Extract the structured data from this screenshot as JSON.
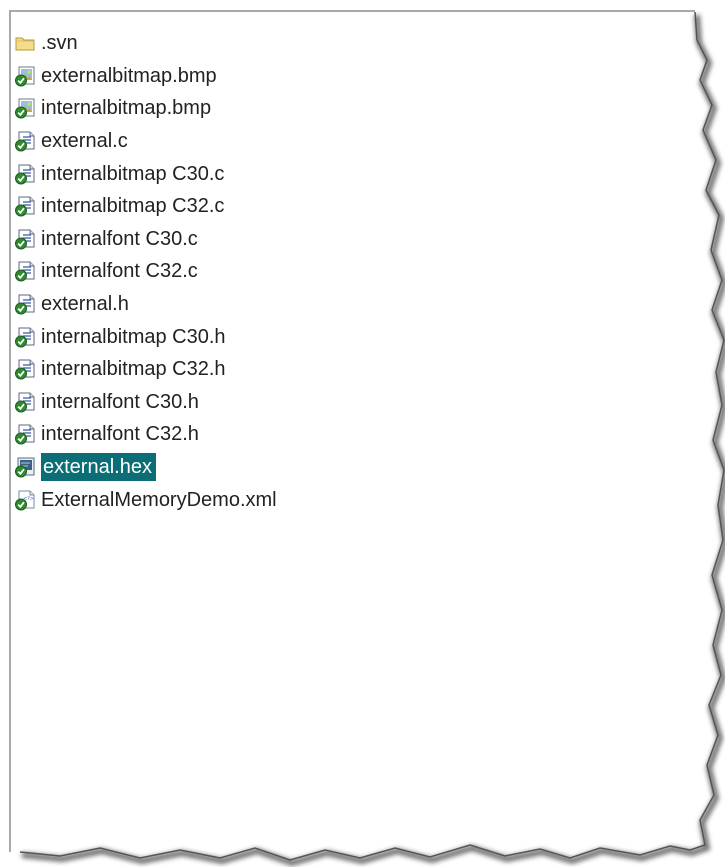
{
  "file_list": {
    "items": [
      {
        "name": ".svn",
        "icon": "folder-icon",
        "selected": false
      },
      {
        "name": "externalbitmap.bmp",
        "icon": "bitmap-file-icon",
        "selected": false
      },
      {
        "name": "internalbitmap.bmp",
        "icon": "bitmap-file-icon",
        "selected": false
      },
      {
        "name": "external.c",
        "icon": "source-file-icon",
        "selected": false
      },
      {
        "name": "internalbitmap C30.c",
        "icon": "source-file-icon",
        "selected": false
      },
      {
        "name": "internalbitmap C32.c",
        "icon": "source-file-icon",
        "selected": false
      },
      {
        "name": "internalfont C30.c",
        "icon": "source-file-icon",
        "selected": false
      },
      {
        "name": "internalfont C32.c",
        "icon": "source-file-icon",
        "selected": false
      },
      {
        "name": "external.h",
        "icon": "source-file-icon",
        "selected": false
      },
      {
        "name": "internalbitmap C30.h",
        "icon": "source-file-icon",
        "selected": false
      },
      {
        "name": "internalbitmap C32.h",
        "icon": "source-file-icon",
        "selected": false
      },
      {
        "name": "internalfont C30.h",
        "icon": "source-file-icon",
        "selected": false
      },
      {
        "name": "internalfont C32.h",
        "icon": "source-file-icon",
        "selected": false
      },
      {
        "name": "external.hex",
        "icon": "hex-file-icon",
        "selected": true
      },
      {
        "name": "ExternalMemoryDemo.xml",
        "icon": "xml-file-icon",
        "selected": false
      }
    ]
  },
  "colors": {
    "selection": "#0b6d75",
    "svn_check": "#2e8b2e"
  }
}
